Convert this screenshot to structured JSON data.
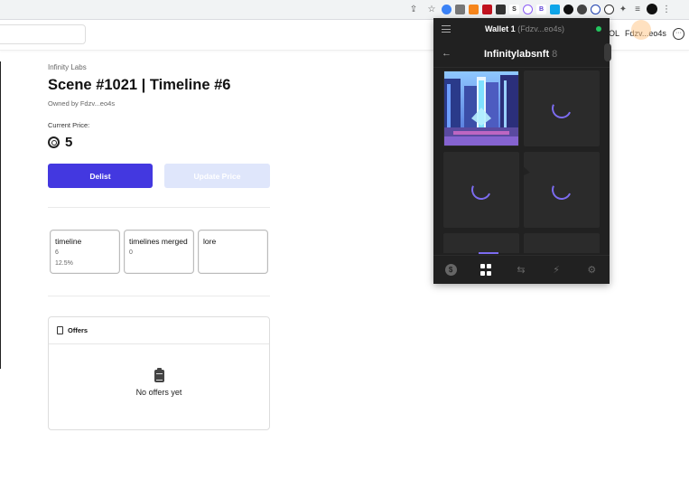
{
  "header": {
    "sol_label": "OL",
    "wallet_short": "Fdzv...eo4s",
    "more_label": "···"
  },
  "nft": {
    "collection": "Infinity Labs",
    "title": "Scene #1021 | Timeline #6",
    "owner": "Owned by Fdzv...eo4s",
    "price_label": "Current Price:",
    "price_value": "5",
    "delist_label": "Delist",
    "update_label": "Update Price"
  },
  "traits": [
    {
      "name": "timeline",
      "value": "6",
      "rarity": "12.5%"
    },
    {
      "name": "timelines merged",
      "value": "0",
      "rarity": ""
    },
    {
      "name": "lore",
      "value": "",
      "rarity": ""
    }
  ],
  "offers": {
    "heading": "Offers",
    "empty_text": "No offers yet"
  },
  "wallet": {
    "name": "Wallet 1",
    "address": "(Fdzv...eo4s)",
    "collection": "Infinitylabsnft",
    "count": "8",
    "status_color": "#22c55e",
    "accent": "#7c6cf0",
    "nav": [
      "dollar-icon",
      "grid-icon",
      "swap-icon",
      "lightning-icon",
      "gear-icon"
    ]
  },
  "colors": {
    "primary": "#4338e0",
    "disabled": "#dfe6fb"
  }
}
